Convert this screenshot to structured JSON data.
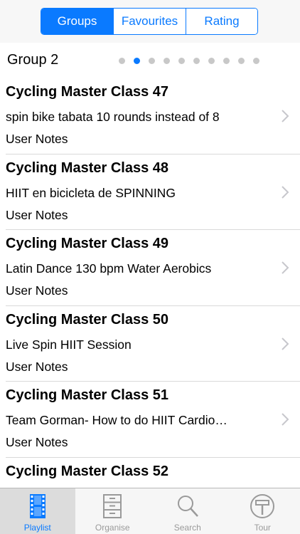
{
  "segments": [
    {
      "label": "Groups",
      "active": true
    },
    {
      "label": "Favourites",
      "active": false
    },
    {
      "label": "Rating",
      "active": false
    }
  ],
  "group": {
    "title": "Group 2",
    "page_count": 10,
    "current_page_index": 1
  },
  "items": [
    {
      "title": "Cycling Master Class 47",
      "subtitle": "spin bike tabata 10 rounds instead of 8",
      "notes": "User Notes"
    },
    {
      "title": "Cycling Master Class 48",
      "subtitle": "HIIT en bicicleta de SPINNING",
      "notes": "User Notes"
    },
    {
      "title": "Cycling Master Class 49",
      "subtitle": "Latin Dance 130 bpm Water Aerobics",
      "notes": "User Notes"
    },
    {
      "title": "Cycling Master Class 50",
      "subtitle": "Live Spin HIIT Session",
      "notes": "User Notes"
    },
    {
      "title": "Cycling Master Class 51",
      "subtitle": "Team Gorman- How to do HIIT Cardio…",
      "notes": "User Notes"
    },
    {
      "title": "Cycling Master Class 52",
      "subtitle": "",
      "notes": ""
    }
  ],
  "tabs": [
    {
      "label": "Playlist",
      "icon": "film-icon",
      "active": true
    },
    {
      "label": "Organise",
      "icon": "cabinet-icon",
      "active": false
    },
    {
      "label": "Search",
      "icon": "magnifier-icon",
      "active": false
    },
    {
      "label": "Tour",
      "icon": "signpost-icon",
      "active": false
    }
  ],
  "colors": {
    "accent": "#0a7aff",
    "inactive_tab": "#9a9a9a",
    "separator": "#d9d9d9"
  }
}
